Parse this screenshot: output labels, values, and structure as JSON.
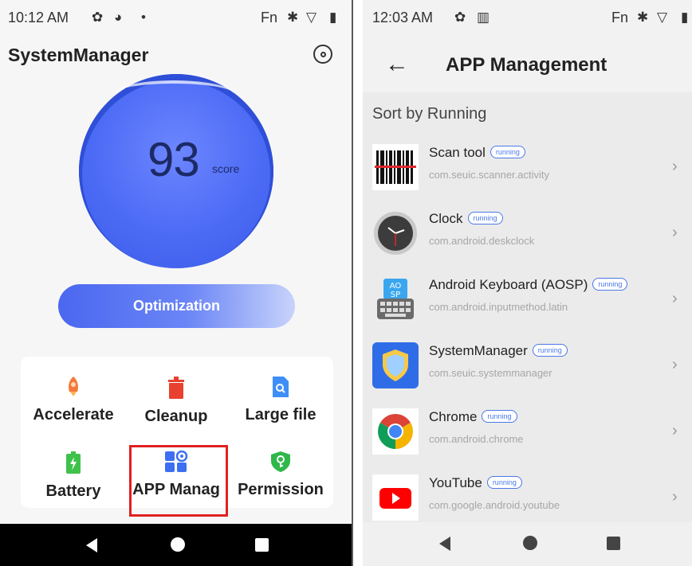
{
  "left": {
    "status": {
      "time": "10:12 AM",
      "fn": "Fn",
      "dot": "•"
    },
    "title": "SystemManager",
    "score": {
      "value": "93",
      "unit": "score"
    },
    "optimize_label": "Optimization",
    "tools": [
      {
        "label": "Accelerate",
        "icon": "rocket-icon"
      },
      {
        "label": "Cleanup",
        "icon": "trash-icon"
      },
      {
        "label": "Large file",
        "icon": "file-search-icon"
      },
      {
        "label": "Battery",
        "icon": "battery-icon"
      },
      {
        "label": "APP Manag",
        "icon": "app-grid-icon"
      },
      {
        "label": "Permission",
        "icon": "shield-key-icon"
      }
    ]
  },
  "right": {
    "status": {
      "time": "12:03 AM",
      "fn": "Fn"
    },
    "title": "APP Management",
    "sort_label": "Sort by Running",
    "badge": "running",
    "apps": [
      {
        "name": "Scan tool",
        "pkg": "com.seuic.scanner.activity",
        "icon": "barcode-icon"
      },
      {
        "name": "Clock",
        "pkg": "com.android.deskclock",
        "icon": "clock-icon"
      },
      {
        "name": "Android Keyboard (AOSP)",
        "pkg": "com.android.inputmethod.latin",
        "icon": "keyboard-icon",
        "icon_text": "AO SP"
      },
      {
        "name": "SystemManager",
        "pkg": "com.seuic.systemmanager",
        "icon": "shield-app-icon"
      },
      {
        "name": "Chrome",
        "pkg": "com.android.chrome",
        "icon": "chrome-icon"
      },
      {
        "name": "YouTube",
        "pkg": "com.google.android.youtube",
        "icon": "youtube-icon"
      }
    ]
  },
  "colors": {
    "accent": "#4c6bf5",
    "highlight": "#e02020",
    "badge": "#4a78e8"
  }
}
